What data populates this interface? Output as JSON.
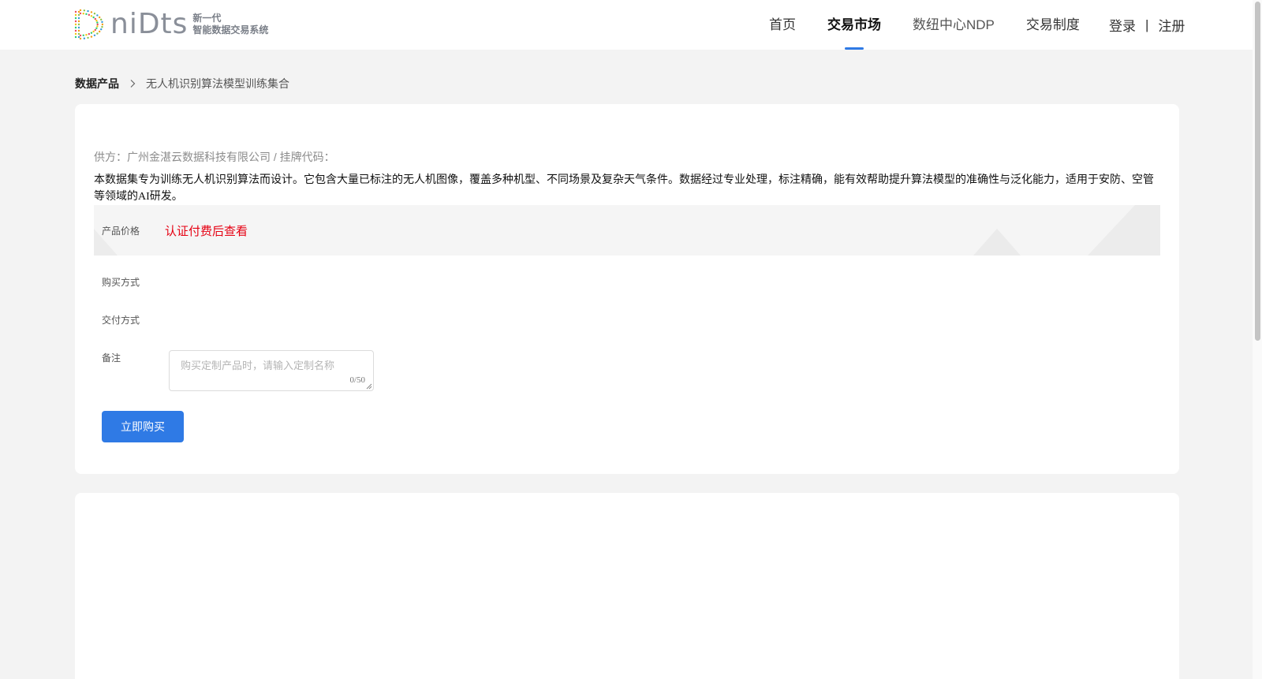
{
  "header": {
    "logo": {
      "word": "niDts",
      "tagline_line1": "新一代",
      "tagline_line2": "智能数据交易系统"
    },
    "nav": [
      {
        "label": "首页",
        "active": false
      },
      {
        "label": "交易市场",
        "active": true
      },
      {
        "label": "数纽中心NDP",
        "active": false
      },
      {
        "label": "交易制度",
        "active": false
      }
    ],
    "auth": {
      "login": "登录",
      "separator": "|",
      "register": "注册"
    }
  },
  "breadcrumb": {
    "root": "数据产品",
    "current": "无人机识别算法模型训练集合"
  },
  "product": {
    "supplier_line": "供方：广州金湛云数据科技有限公司 / 挂牌代码：",
    "description": "本数据集专为训练无人机识别算法而设计。它包含大量已标注的无人机图像，覆盖多种机型、不同场景及复杂天气条件。数据经过专业处理，标注精确，能有效帮助提升算法模型的准确性与泛化能力，适用于安防、空管等领域的AI研发。",
    "price_label": "产品价格",
    "price_value": "认证付费后查看",
    "purchase_method_label": "购买方式",
    "delivery_method_label": "交付方式",
    "remark_label": "备注",
    "remark_placeholder": "购买定制产品时，请输入定制名称",
    "remark_value": "",
    "remark_counter": "0/50",
    "buy_button": "立即购买"
  },
  "colors": {
    "accent": "#2f7ae5",
    "price": "#e60012",
    "page_bg": "#f3f3f3"
  }
}
